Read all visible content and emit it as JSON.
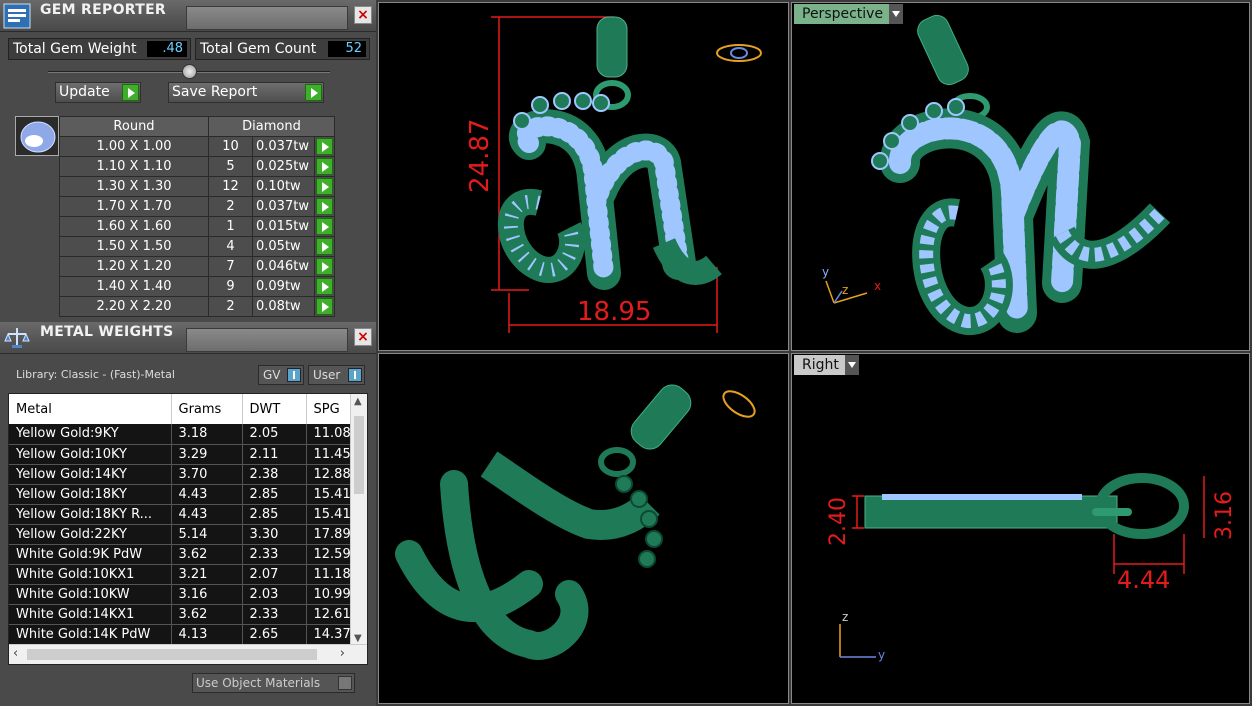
{
  "gem_panel": {
    "title": "GEM REPORTER",
    "total_weight_label": "Total Gem Weight",
    "total_weight_value": ".48",
    "total_count_label": "Total Gem Count",
    "total_count_value": "52",
    "update_label": "Update",
    "save_label": "Save Report",
    "table_headers": [
      "Round",
      "Diamond"
    ],
    "rows": [
      {
        "size": "1.00 X 1.00",
        "count": "10",
        "tw": "0.037tw"
      },
      {
        "size": "1.10 X 1.10",
        "count": "5",
        "tw": "0.025tw"
      },
      {
        "size": "1.30 X 1.30",
        "count": "12",
        "tw": "0.10tw"
      },
      {
        "size": "1.70 X 1.70",
        "count": "2",
        "tw": "0.037tw"
      },
      {
        "size": "1.60 X 1.60",
        "count": "1",
        "tw": "0.015tw"
      },
      {
        "size": "1.50 X 1.50",
        "count": "4",
        "tw": "0.05tw"
      },
      {
        "size": "1.20 X 1.20",
        "count": "7",
        "tw": "0.046tw"
      },
      {
        "size": "1.40 X 1.40",
        "count": "9",
        "tw": "0.09tw"
      },
      {
        "size": "2.20 X 2.20",
        "count": "2",
        "tw": "0.08tw"
      }
    ]
  },
  "metal_panel": {
    "title": "METAL WEIGHTS",
    "library_label": "Library: Classic - (Fast)-Metal",
    "gv_label": "GV",
    "user_label": "User",
    "headers": [
      "Metal",
      "Grams",
      "DWT",
      "SPG"
    ],
    "rows": [
      {
        "metal": "Yellow Gold:9KY",
        "grams": "3.18",
        "dwt": "2.05",
        "spg": "11.08"
      },
      {
        "metal": "Yellow Gold:10KY",
        "grams": "3.29",
        "dwt": "2.11",
        "spg": "11.45"
      },
      {
        "metal": "Yellow Gold:14KY",
        "grams": "3.70",
        "dwt": "2.38",
        "spg": "12.88"
      },
      {
        "metal": "Yellow Gold:18KY",
        "grams": "4.43",
        "dwt": "2.85",
        "spg": "15.41"
      },
      {
        "metal": "Yellow Gold:18KY R...",
        "grams": "4.43",
        "dwt": "2.85",
        "spg": "15.41"
      },
      {
        "metal": "Yellow Gold:22KY",
        "grams": "5.14",
        "dwt": "3.30",
        "spg": "17.89"
      },
      {
        "metal": "White Gold:9K PdW",
        "grams": "3.62",
        "dwt": "2.33",
        "spg": "12.59"
      },
      {
        "metal": "White Gold:10KX1",
        "grams": "3.21",
        "dwt": "2.07",
        "spg": "11.18"
      },
      {
        "metal": "White Gold:10KW",
        "grams": "3.16",
        "dwt": "2.03",
        "spg": "10.99"
      },
      {
        "metal": "White Gold:14KX1",
        "grams": "3.62",
        "dwt": "2.33",
        "spg": "12.61"
      },
      {
        "metal": "White Gold:14K PdW",
        "grams": "4.13",
        "dwt": "2.65",
        "spg": "14.37"
      }
    ],
    "use_materials_label": "Use Object Materials"
  },
  "viewports": {
    "top": {
      "dim_height": "24.87",
      "dim_width": "18.95"
    },
    "perspective": {
      "label": "Perspective",
      "axis_y": "y",
      "axis_z": "z",
      "axis_x": "x"
    },
    "right": {
      "label": "Right",
      "dim_a": "2.40",
      "dim_b": "3.16",
      "dim_c": "4.44",
      "axis_z": "z",
      "axis_y": "y"
    }
  },
  "colors": {
    "metal_green": "#1f7a58",
    "gem_blue": "#9fc6ff",
    "dimension_red": "#e31b1b",
    "perspective_tab": "#7ab38a",
    "right_tab": "#c9c9c9"
  }
}
